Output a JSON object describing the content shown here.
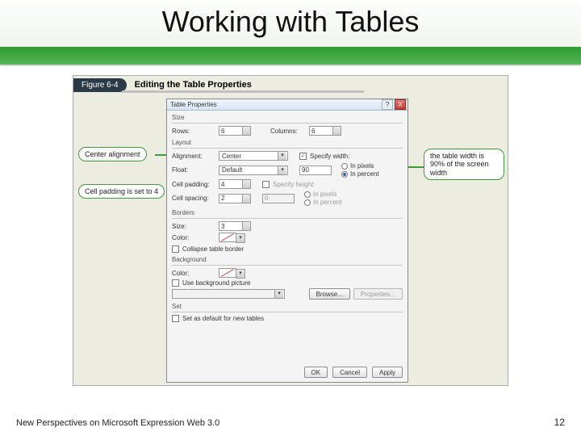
{
  "slide": {
    "title": "Working with Tables",
    "figure_tag": "Figure 6-4",
    "figure_label": "Editing the Table Properties",
    "footer_left": "New Perspectives on Microsoft Expression Web 3.0",
    "footer_right": "12"
  },
  "callouts": {
    "center_align": "Center alignment",
    "cell_padding": "Cell padding is set to 4",
    "width_note": "the table width is 90% of the screen width"
  },
  "dialog": {
    "title": "Table Properties",
    "help": "?",
    "close": "X",
    "groups": {
      "size": "Size",
      "layout": "Layout",
      "borders": "Borders",
      "background": "Background",
      "set": "Set"
    },
    "size": {
      "rows_label": "Rows:",
      "rows_value": "6",
      "columns_label": "Columns:",
      "columns_value": "6"
    },
    "layout": {
      "alignment_label": "Alignment:",
      "alignment_value": "Center",
      "float_label": "Float:",
      "float_value": "Default",
      "cell_padding_label": "Cell padding:",
      "cell_padding_value": "4",
      "cell_spacing_label": "Cell spacing:",
      "cell_spacing_value": "2",
      "specify_width_label": "Specify width:",
      "specify_width_checked": "✓",
      "width_value": "90",
      "in_pixels": "In pixels",
      "in_percent": "In percent",
      "specify_height_label": "Specify height:",
      "height_value": "0"
    },
    "borders": {
      "size_label": "Size:",
      "size_value": "3",
      "color_label": "Color:",
      "collapse_label": "Collapse table border"
    },
    "background": {
      "color_label": "Color:",
      "use_bg_pic_label": "Use background picture",
      "browse": "Browse...",
      "properties": "Properties..."
    },
    "set": {
      "default_label": "Set as default for new tables"
    },
    "buttons": {
      "ok": "OK",
      "cancel": "Cancel",
      "apply": "Apply"
    }
  }
}
